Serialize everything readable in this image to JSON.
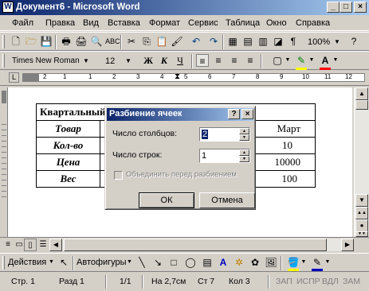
{
  "window": {
    "title": "Документ6 - Microsoft Word",
    "min": "_",
    "max": "□",
    "close": "×"
  },
  "menu": [
    "Файл",
    "Правка",
    "Вид",
    "Вставка",
    "Формат",
    "Сервис",
    "Таблица",
    "Окно",
    "Справка"
  ],
  "standard_toolbar": {
    "zoom": "100%"
  },
  "format_toolbar": {
    "font": "Times New Roman",
    "size": "12",
    "bold": "Ж",
    "italic": "К",
    "underline": "Ч"
  },
  "ruler": {
    "numbers": [
      "1",
      "2",
      "1",
      "2",
      "3",
      "4",
      "5",
      "6",
      "7",
      "8",
      "9",
      "10",
      "11",
      "12"
    ]
  },
  "document": {
    "heading": "Квартальный",
    "rows": [
      [
        "Товар",
        "Март"
      ],
      [
        "Кол-во",
        "10"
      ],
      [
        "Цена",
        "10000"
      ],
      [
        "Вес",
        "100"
      ]
    ]
  },
  "dialog": {
    "title": "Разбиение ячеек",
    "help": "?",
    "close": "×",
    "columns_label": "Число столбцов:",
    "columns_value": "2",
    "rows_label": "Число строк:",
    "rows_value": "1",
    "merge_label": "Объединить перед разбиением",
    "ok": "ОК",
    "cancel": "Отмена"
  },
  "draw_toolbar": {
    "actions": "Действия",
    "autoshapes": "Автофигуры"
  },
  "status": {
    "page": "Стр. 1",
    "section": "Разд 1",
    "pages": "1/1",
    "at": "На 2,7см",
    "line": "Ст 7",
    "col": "Кол 3",
    "rec": "ЗАП",
    "trk": "ИСПР",
    "ext": "ВДЛ",
    "ovr": "ЗАМ"
  },
  "colors": {
    "title_start": "#0a246a",
    "title_end": "#a6caf0",
    "face": "#d4d0c8"
  }
}
